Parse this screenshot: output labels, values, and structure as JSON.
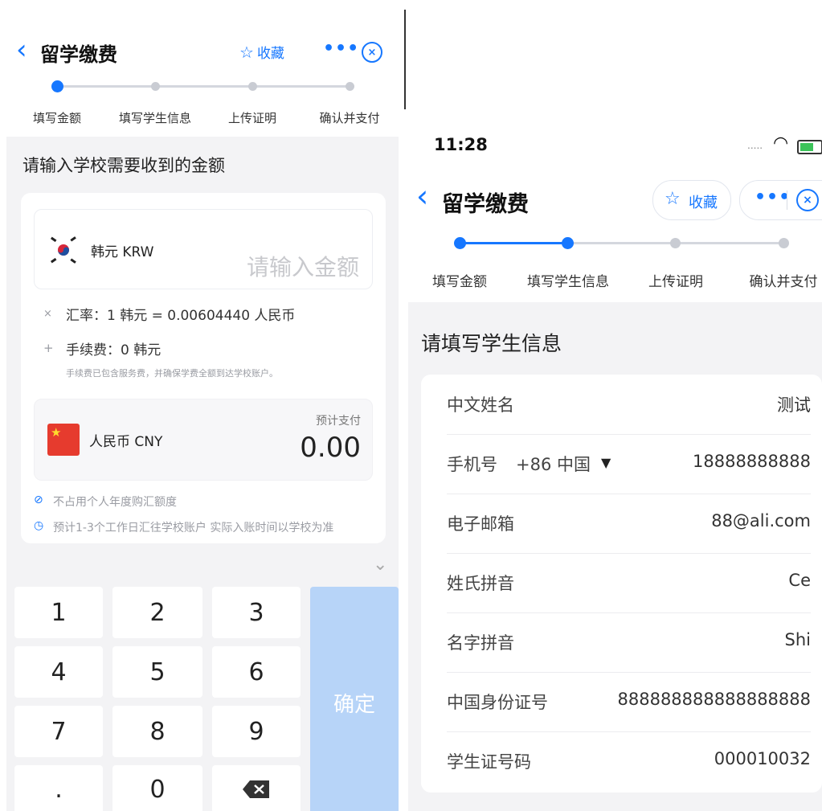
{
  "left": {
    "header": {
      "title": "留学缴费",
      "favorite_label": "收藏"
    },
    "steps": [
      "填写金额",
      "填写学生信息",
      "上传证明",
      "确认并支付"
    ],
    "section_title": "请输入学校需要收到的金额",
    "source_currency": {
      "name": "韩元 KRW",
      "amount_placeholder": "请输入金额"
    },
    "exchange_rate": "汇率：1 韩元 = 0.00604440 人民币",
    "fee": "手续费：0 韩元",
    "fee_note": "手续费已包含服务费，并确保学费全额到达学校账户。",
    "target_currency": {
      "name": "人民币 CNY",
      "estimate_label": "预计支付",
      "amount": "0.00"
    },
    "notes": [
      "不占用个人年度购汇额度",
      "预计1-3个工作日汇往学校账户 实际入账时间以学校为准"
    ],
    "keypad": {
      "keys": [
        "1",
        "2",
        "3",
        "4",
        "5",
        "6",
        "7",
        "8",
        "9",
        ".",
        "0"
      ],
      "confirm_label": "确定"
    }
  },
  "right": {
    "status_bar": {
      "time": "11:28"
    },
    "header": {
      "title": "留学缴费",
      "favorite_label": "收藏"
    },
    "steps": [
      "填写金额",
      "填写学生信息",
      "上传证明",
      "确认并支付"
    ],
    "section_title": "请填写学生信息",
    "form": {
      "chinese_name": {
        "label": "中文姓名",
        "value": "测试"
      },
      "phone": {
        "label": "手机号",
        "country_code": "+86 中国",
        "value": "18888888888"
      },
      "email": {
        "label": "电子邮箱",
        "value": "88@ali.com"
      },
      "surname_pinyin": {
        "label": "姓氏拼音",
        "value": "Ce"
      },
      "given_name_pinyin": {
        "label": "名字拼音",
        "value": "Shi"
      },
      "id_number": {
        "label": "中国身份证号",
        "value": "888888888888888888"
      },
      "student_id": {
        "label": "学生证号码",
        "value": "000010032"
      }
    }
  },
  "colors": {
    "accent": "#1677ff",
    "confirm_disabled": "#b7d4f8",
    "background": "#f3f3f5"
  }
}
